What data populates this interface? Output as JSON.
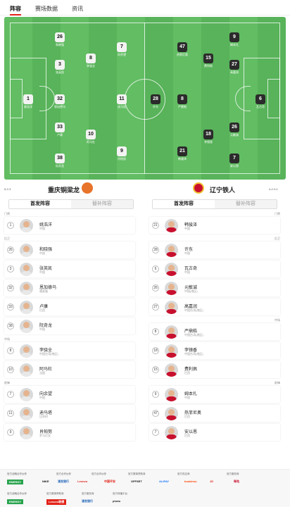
{
  "tabs": [
    "阵容",
    "赛场数据",
    "资讯"
  ],
  "pitch": {
    "home_players": [
      {
        "num": "26",
        "name": "和晓强"
      },
      {
        "num": "3",
        "name": "张英凯"
      },
      {
        "num": "1",
        "name": "姚浩洋"
      },
      {
        "num": "32",
        "name": "恩加德乌"
      },
      {
        "num": "33",
        "name": "卢康"
      },
      {
        "num": "38",
        "name": "阮奇龙"
      },
      {
        "num": "8",
        "name": "李骁全"
      },
      {
        "num": "10",
        "name": "阿马杜"
      },
      {
        "num": "7",
        "name": "向余望"
      },
      {
        "num": "11",
        "name": "迪马塔"
      },
      {
        "num": "9",
        "name": "肖帕努"
      }
    ],
    "away_players": [
      {
        "num": "7",
        "name": "安以恩"
      },
      {
        "num": "9",
        "name": "姆本扎"
      },
      {
        "num": "47",
        "name": "热菲尼奥"
      },
      {
        "num": "8",
        "name": "严鼎皓"
      },
      {
        "num": "18",
        "name": "李镜香"
      },
      {
        "num": "15",
        "name": "费利佩"
      },
      {
        "num": "27",
        "name": "高嘉润"
      },
      {
        "num": "26",
        "name": "元敏诚"
      },
      {
        "num": "6",
        "name": "瓦古奇"
      },
      {
        "num": "28",
        "name": "许东"
      },
      {
        "num": "21",
        "name": "韩骏泽"
      }
    ]
  },
  "teams": {
    "home": {
      "name": "重庆铜梁龙",
      "formation": "5-2-3"
    },
    "away": {
      "name": "辽宁铁人",
      "formation": "4-2-3-1"
    }
  },
  "subtabs": {
    "starting": "首发阵容",
    "bench": "替补阵容"
  },
  "sections": {
    "gk": "门将",
    "df": "后卫",
    "mf": "中场",
    "fw": "前锋"
  },
  "home_list": {
    "gk": [
      {
        "num": "1",
        "name": "姚浩洋",
        "nat": "中国"
      }
    ],
    "df": [
      {
        "num": "26",
        "name": "和晓强",
        "nat": "中国"
      },
      {
        "num": "3",
        "name": "张英凯",
        "nat": "中国"
      },
      {
        "num": "32",
        "name": "恩加德乌",
        "nat": "喀麦隆"
      },
      {
        "num": "33",
        "name": "卢康",
        "nat": "巴西"
      },
      {
        "num": "38",
        "name": "阮奇龙",
        "nat": "中国"
      }
    ],
    "mf": [
      {
        "num": "8",
        "name": "李骁全",
        "nat": "中国台湾(地区)"
      },
      {
        "num": "10",
        "name": "阿马杜",
        "nat": "法国"
      }
    ],
    "fw": [
      {
        "num": "7",
        "name": "向余望",
        "nat": "中国"
      },
      {
        "num": "11",
        "name": "迪马塔",
        "nat": "比利时"
      },
      {
        "num": "9",
        "name": "肖帕努",
        "nat": "罗马尼亚"
      }
    ]
  },
  "away_list": {
    "gk": [
      {
        "num": "21",
        "name": "韩骏泽",
        "nat": "中国"
      }
    ],
    "df": [
      {
        "num": "28",
        "name": "许东",
        "nat": "中国"
      },
      {
        "num": "6",
        "name": "瓦古奇",
        "nat": "中国"
      },
      {
        "num": "26",
        "name": "元敏诚",
        "nat": "中国(地区)"
      },
      {
        "num": "27",
        "name": "高嘉润",
        "nat": "中国台湾(地区)"
      }
    ],
    "mf": [
      {
        "num": "8",
        "name": "严鼎皓",
        "nat": "中国台湾(地区)"
      },
      {
        "num": "18",
        "name": "李镜香",
        "nat": "中国台湾(地区)"
      },
      {
        "num": "15",
        "name": "费利佩",
        "nat": "巴西"
      }
    ],
    "fw": [
      {
        "num": "9",
        "name": "姆本扎",
        "nat": "中国"
      },
      {
        "num": "47",
        "name": "热菲尼奥",
        "nat": "巴西"
      },
      {
        "num": "7",
        "name": "安以恩",
        "nat": "巴西"
      }
    ]
  },
  "sponsors": {
    "titles": [
      "官方战略合作伙伴",
      "官方合作伙伴",
      "官方赛事赞助商",
      "官方供应商",
      "官方服务商",
      "官方转播平台"
    ],
    "logos": [
      "ENERGY",
      "NIKE",
      "浦发银行",
      "Lenovo",
      "中国平安",
      "OFFSET",
      "ALIPAY",
      "kuaishou",
      "JD",
      "咪咕",
      "Lenovo联想",
      "photo"
    ]
  },
  "colors": {
    "accent": "#e2231a",
    "pitch": "#58b35a",
    "home_kit": "#e8e8e8",
    "away_kit": "#c8102e"
  }
}
